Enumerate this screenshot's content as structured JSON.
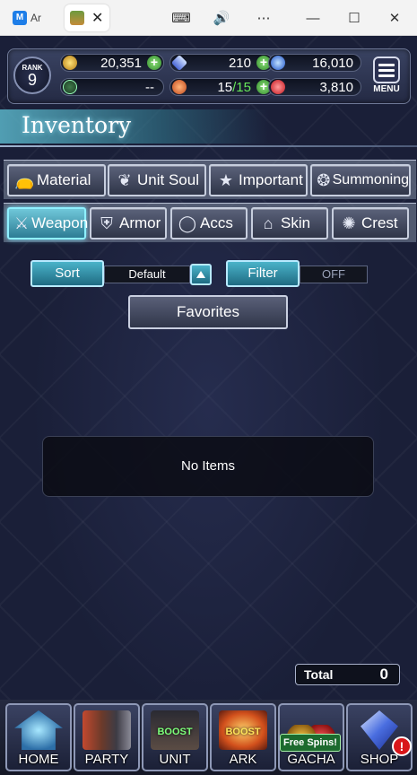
{
  "browser": {
    "tab1_label": "Ar",
    "tab_close": "✕",
    "controls": {
      "keyboard": "⌨",
      "sound": "🔊",
      "more": "⋯",
      "minimize": "—",
      "maximize": "☐",
      "close": "✕"
    }
  },
  "hud": {
    "rank_label": "RANK",
    "rank_value": "9",
    "gold": "20,351",
    "crystals": "210",
    "orbs": "16,010",
    "unknown": "--",
    "stamina_current": "15",
    "stamina_max": "/15",
    "rubies": "3,810",
    "menu_label": "MENU"
  },
  "inventory_title": "Inventory",
  "categories_row1": [
    {
      "label": "Material",
      "icon": "material-icon"
    },
    {
      "label": "Unit Soul",
      "icon": "unit-soul-icon"
    },
    {
      "label": "Important",
      "icon": "star-icon"
    },
    {
      "label": "Summoning",
      "icon": "summoning-icon"
    }
  ],
  "categories_row2": [
    {
      "label": "Weapon",
      "icon": "sword-icon",
      "active": true
    },
    {
      "label": "Armor",
      "icon": "armor-icon"
    },
    {
      "label": "Accs",
      "icon": "ring-icon"
    },
    {
      "label": "Skin",
      "icon": "hanger-icon"
    },
    {
      "label": "Crest",
      "icon": "crest-icon"
    }
  ],
  "sort": {
    "label": "Sort",
    "value": "Default"
  },
  "filter": {
    "label": "Filter",
    "value": "OFF"
  },
  "favorites_label": "Favorites",
  "empty_message": "No Items",
  "total": {
    "label": "Total",
    "value": "0"
  },
  "nav": [
    {
      "label": "HOME"
    },
    {
      "label": "PARTY"
    },
    {
      "label": "UNIT",
      "boost": "BOOST"
    },
    {
      "label": "ARK",
      "boost": "BOOST"
    },
    {
      "label": "GACHA",
      "badge": "Free Spins!"
    },
    {
      "label": "SHOP",
      "alert": "!"
    }
  ],
  "colors": {
    "accent": "#4ab3c9",
    "active_glow": "#8ff0ff",
    "background": "#1a1f38"
  }
}
